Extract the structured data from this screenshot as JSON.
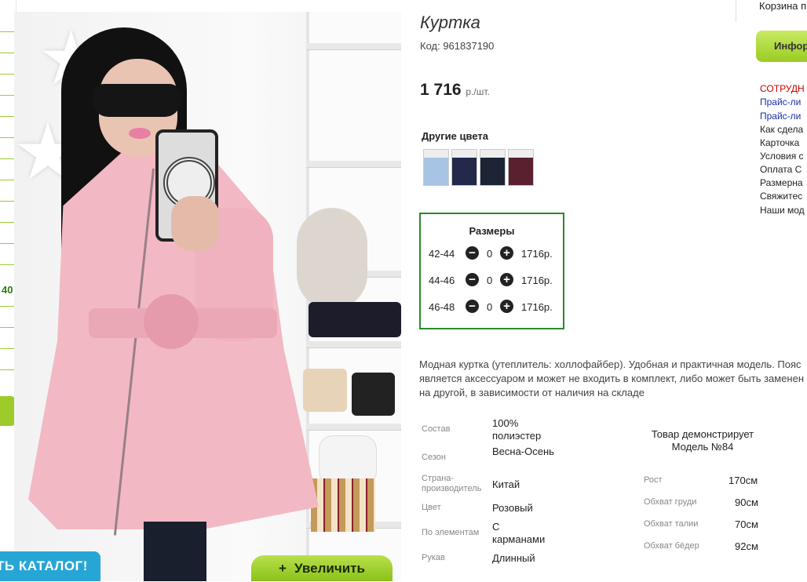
{
  "left_strip": {
    "number": "40"
  },
  "photo": {
    "catalog_button_label": "ТЬ КАТАЛОГ!",
    "zoom_button_label": "Увеличить",
    "zoom_plus": "+"
  },
  "product": {
    "title": "Куртка",
    "code": "Код: 961837190",
    "price": "1 716",
    "price_unit": "р./шт.",
    "other_colors_title": "Другие цвета",
    "other_colors": [
      {
        "name": "light-blue",
        "color": "#a8c4e4"
      },
      {
        "name": "navy",
        "color": "#22294a"
      },
      {
        "name": "black-blue",
        "color": "#1d2436"
      },
      {
        "name": "burgundy",
        "color": "#5a2030"
      }
    ],
    "sizes_title": "Размеры",
    "sizes": [
      {
        "size": "42-44",
        "qty": "0",
        "price": "1716р."
      },
      {
        "size": "44-46",
        "qty": "0",
        "price": "1716р."
      },
      {
        "size": "46-48",
        "qty": "0",
        "price": "1716р."
      }
    ],
    "minus": "−",
    "plus": "+",
    "description": "Модная куртка (утеплитель: холлофайбер). Удобная и практичная модель. Пояс является аксессуаром и может не входить в комплект, либо может быть заменен на другой, в зависимости от наличия на складе",
    "properties": [
      {
        "label": "Состав",
        "value": "100% полиэстер"
      },
      {
        "label": "Сезон",
        "value": "Весна-Осень"
      },
      {
        "label": "Страна-производитель",
        "value": "Китай"
      },
      {
        "label": "Цвет",
        "value": "Розовый"
      },
      {
        "label": "По элементам",
        "value": "С карманами"
      },
      {
        "label": "Рукав",
        "value": "Длинный"
      }
    ],
    "model_title": "Товар демонстрирует Модель №84",
    "measurements": [
      {
        "label": "Рост",
        "value": "170см"
      },
      {
        "label": "Обхват груди",
        "value": "90см"
      },
      {
        "label": "Обхват талии",
        "value": "70см"
      },
      {
        "label": "Обхват бёдер",
        "value": "92см"
      }
    ]
  },
  "sidebar": {
    "cart": "Корзина п",
    "info_button": "Инфор",
    "links": [
      {
        "text": "СОТРУДН",
        "color": "#cc0000"
      },
      {
        "text": "Прайс-ли",
        "color": "#1a2fb0"
      },
      {
        "text": "Прайс-ли",
        "color": "#1a2fb0"
      },
      {
        "text": "Как сдела",
        "color": "#222222"
      },
      {
        "text": "Карточка",
        "color": "#222222"
      },
      {
        "text": "Условия с",
        "color": "#222222"
      },
      {
        "text": "Оплата С",
        "color": "#222222"
      },
      {
        "text": "Размерна",
        "color": "#222222"
      },
      {
        "text": "Свяжитес",
        "color": "#222222"
      },
      {
        "text": "Наши мод",
        "color": "#222222"
      }
    ]
  }
}
